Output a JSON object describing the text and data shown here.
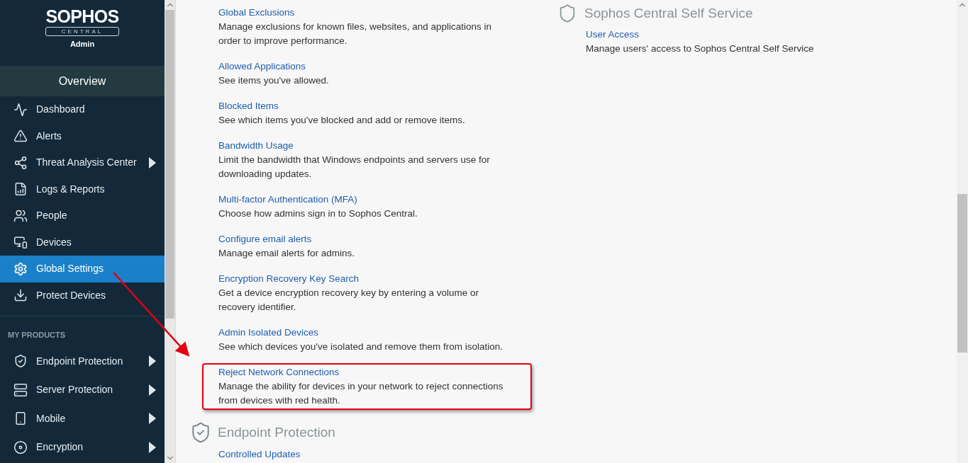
{
  "sidebar": {
    "logo": {
      "brand": "SOPHOS",
      "product": "CENTRAL",
      "role": "Admin"
    },
    "overview": "Overview",
    "items": [
      {
        "label": "Dashboard",
        "selected": false,
        "expandable": false
      },
      {
        "label": "Alerts",
        "selected": false,
        "expandable": false
      },
      {
        "label": "Threat Analysis Center",
        "selected": false,
        "expandable": true
      },
      {
        "label": "Logs & Reports",
        "selected": false,
        "expandable": false
      },
      {
        "label": "People",
        "selected": false,
        "expandable": false
      },
      {
        "label": "Devices",
        "selected": false,
        "expandable": false
      },
      {
        "label": "Global Settings",
        "selected": true,
        "expandable": false
      },
      {
        "label": "Protect Devices",
        "selected": false,
        "expandable": false
      }
    ],
    "products_heading": "MY PRODUCTS",
    "products": [
      {
        "label": "Endpoint Protection",
        "expandable": true
      },
      {
        "label": "Server Protection",
        "expandable": true
      },
      {
        "label": "Mobile",
        "expandable": true
      },
      {
        "label": "Encryption",
        "expandable": true
      }
    ]
  },
  "left_column": {
    "items": [
      {
        "title": "Global Exclusions",
        "description": "Manage exclusions for known files, websites, and applications in order to improve performance.",
        "highlighted": false
      },
      {
        "title": "Allowed Applications",
        "description": "See items you've allowed.",
        "highlighted": false
      },
      {
        "title": "Blocked Items",
        "description": "See which items you've blocked and add or remove items.",
        "highlighted": false
      },
      {
        "title": "Bandwidth Usage",
        "description": "Limit the bandwidth that Windows endpoints and servers use for downloading updates.",
        "highlighted": false
      },
      {
        "title": "Multi-factor Authentication (MFA)",
        "description": "Choose how admins sign in to Sophos Central.",
        "highlighted": false
      },
      {
        "title": "Configure email alerts",
        "description": "Manage email alerts for admins.",
        "highlighted": false
      },
      {
        "title": "Encryption Recovery Key Search",
        "description": "Get a device encryption recovery key by entering a volume or recovery identifier.",
        "highlighted": false
      },
      {
        "title": "Admin Isolated Devices",
        "description": "See which devices you've isolated and remove them from isolation.",
        "highlighted": false
      },
      {
        "title": "Reject Network Connections",
        "description": "Manage the ability for devices in your network to reject connections from devices with red health.",
        "highlighted": true
      }
    ],
    "section": {
      "heading": "Endpoint Protection",
      "items": [
        {
          "title": "Controlled Updates"
        }
      ]
    }
  },
  "right_column": {
    "heading": "Sophos Central Self Service",
    "items": [
      {
        "title": "User Access",
        "description": "Manage users' access to Sophos Central Self Service"
      }
    ]
  },
  "annotation": {
    "arrow": true
  }
}
